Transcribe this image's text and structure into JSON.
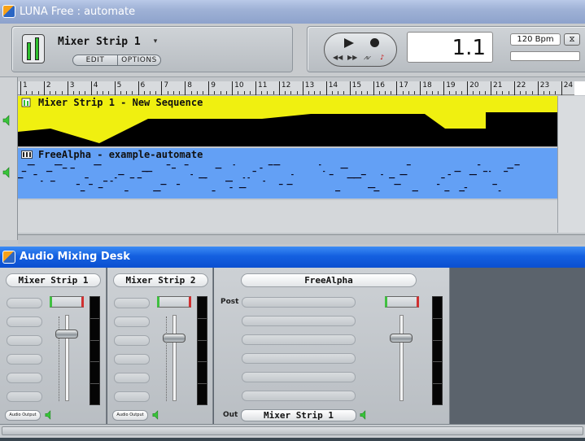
{
  "luna_window": {
    "title": "LUNA Free : automate",
    "strip_selector": {
      "name": "Mixer Strip 1",
      "dropdown_glyph": "▾",
      "edit_label": "EDIT",
      "options_label": "OPTIONS"
    },
    "transport": {
      "play_icon": "play-icon",
      "record_icon": "record-icon",
      "rewind_label": "◀◀",
      "ffwd_label": "▶▶",
      "monitor_label": "⩘⩗",
      "metronome_label": "♪",
      "position": "1.1",
      "bpm": "120 Bpm",
      "metronome_button_label": "⧖"
    },
    "ruler": {
      "bars": [
        "1",
        "2",
        "3",
        "4",
        "5",
        "6",
        "7",
        "8",
        "9",
        "10",
        "11",
        "12",
        "13",
        "14",
        "15",
        "16",
        "17",
        "18",
        "19",
        "20",
        "21",
        "22",
        "23",
        "24"
      ]
    },
    "tracks": [
      {
        "label": "Mixer Strip 1 - New Sequence",
        "color": "#f0f010"
      },
      {
        "label": "FreeAlpha - example-automate",
        "color": "#63a0f5"
      }
    ]
  },
  "mixer_window": {
    "title": "Audio Mixing Desk",
    "strips": [
      {
        "name": "Mixer Strip 1",
        "output": "Audio Output"
      },
      {
        "name": "Mixer Strip 2",
        "output": "Audio Output"
      },
      {
        "name": "FreeAlpha",
        "post_label": "Post",
        "out_label": "Out",
        "output": "Mixer Strip 1"
      }
    ],
    "fader_levels": [
      0.82,
      0.77,
      0.77
    ]
  },
  "colors": {
    "meter_green": "#40c040",
    "peak_red": "#d03030",
    "speaker_green": "#39c43a"
  }
}
